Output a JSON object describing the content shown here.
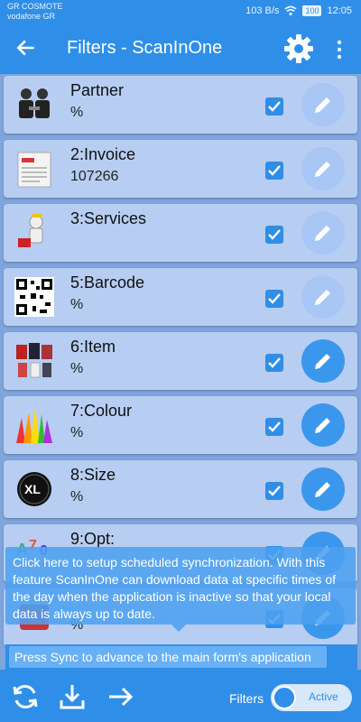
{
  "status": {
    "carrier1": "GR COSMOTE",
    "carrier2": "vodafone GR",
    "speed": "103 B/s",
    "battery": "100",
    "time": "12:05"
  },
  "appbar": {
    "title": "Filters - ScanInOne",
    "icons": [
      "back-arrow-icon",
      "gear-icon",
      "more-vertical-icon"
    ]
  },
  "rows": [
    {
      "title": "Partner",
      "sub": "%",
      "thumb": "partner-icon"
    },
    {
      "title": "2:Invoice",
      "sub": "107266",
      "thumb": "invoice-icon"
    },
    {
      "title": "3:Services",
      "sub": "",
      "thumb": "services-icon"
    },
    {
      "title": "5:Barcode",
      "sub": "%",
      "thumb": "barcode-icon"
    },
    {
      "title": "6:Item",
      "sub": "%",
      "thumb": "item-icon"
    },
    {
      "title": "7:Colour",
      "sub": "%",
      "thumb": "colour-icon"
    },
    {
      "title": "8:Size",
      "sub": "%",
      "thumb": "size-icon"
    },
    {
      "title": "9:Opt:",
      "sub": "",
      "thumb": "option-icon"
    },
    {
      "title": "",
      "sub": "%",
      "thumb": "misc-icon"
    }
  ],
  "tooltip": {
    "text": "Click here to setup scheduled synchronization. With this feature ScanInOne can download data at specific times of the day when the application is inactive so that your local data is always up to date."
  },
  "sync_hint": "Press Sync to advance to the main form's application",
  "bottombar": {
    "filters_label": "Filters",
    "toggle_label": "Active",
    "icons": [
      "sync-icon",
      "download-icon",
      "arrow-right-icon"
    ]
  },
  "colors": {
    "primary": "#2f8fe8",
    "row_bg": "#b7cdf1",
    "list_bg": "#7fa5dc"
  }
}
